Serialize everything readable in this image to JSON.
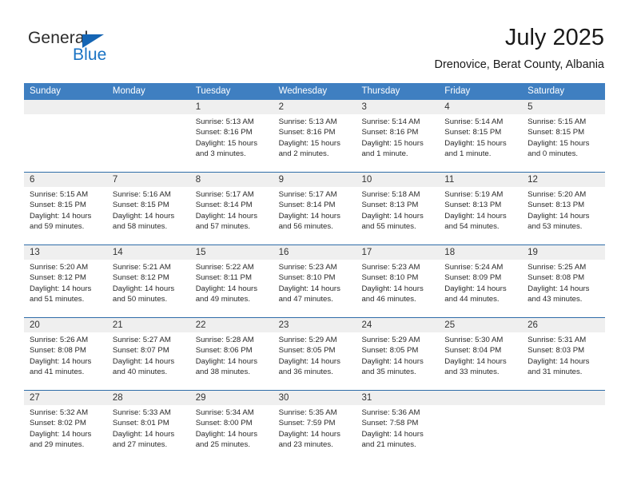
{
  "brand": {
    "name_top": "General",
    "name_bottom": "Blue",
    "accent_color": "#1a73c4",
    "triangle_color": "#1565b4"
  },
  "header": {
    "month_title": "July 2025",
    "location": "Drenovice, Berat County, Albania"
  },
  "theme": {
    "header_row_bg": "#3f7fc1",
    "number_band_bg": "#efefef",
    "row_divider": "#2f6da8",
    "text": "#2a2a2a"
  },
  "weekdays": [
    "Sunday",
    "Monday",
    "Tuesday",
    "Wednesday",
    "Thursday",
    "Friday",
    "Saturday"
  ],
  "weeks": [
    [
      {
        "day": "",
        "sunrise": "",
        "sunset": "",
        "daylight1": "",
        "daylight2": ""
      },
      {
        "day": "",
        "sunrise": "",
        "sunset": "",
        "daylight1": "",
        "daylight2": ""
      },
      {
        "day": "1",
        "sunrise": "Sunrise: 5:13 AM",
        "sunset": "Sunset: 8:16 PM",
        "daylight1": "Daylight: 15 hours",
        "daylight2": "and 3 minutes."
      },
      {
        "day": "2",
        "sunrise": "Sunrise: 5:13 AM",
        "sunset": "Sunset: 8:16 PM",
        "daylight1": "Daylight: 15 hours",
        "daylight2": "and 2 minutes."
      },
      {
        "day": "3",
        "sunrise": "Sunrise: 5:14 AM",
        "sunset": "Sunset: 8:16 PM",
        "daylight1": "Daylight: 15 hours",
        "daylight2": "and 1 minute."
      },
      {
        "day": "4",
        "sunrise": "Sunrise: 5:14 AM",
        "sunset": "Sunset: 8:15 PM",
        "daylight1": "Daylight: 15 hours",
        "daylight2": "and 1 minute."
      },
      {
        "day": "5",
        "sunrise": "Sunrise: 5:15 AM",
        "sunset": "Sunset: 8:15 PM",
        "daylight1": "Daylight: 15 hours",
        "daylight2": "and 0 minutes."
      }
    ],
    [
      {
        "day": "6",
        "sunrise": "Sunrise: 5:15 AM",
        "sunset": "Sunset: 8:15 PM",
        "daylight1": "Daylight: 14 hours",
        "daylight2": "and 59 minutes."
      },
      {
        "day": "7",
        "sunrise": "Sunrise: 5:16 AM",
        "sunset": "Sunset: 8:15 PM",
        "daylight1": "Daylight: 14 hours",
        "daylight2": "and 58 minutes."
      },
      {
        "day": "8",
        "sunrise": "Sunrise: 5:17 AM",
        "sunset": "Sunset: 8:14 PM",
        "daylight1": "Daylight: 14 hours",
        "daylight2": "and 57 minutes."
      },
      {
        "day": "9",
        "sunrise": "Sunrise: 5:17 AM",
        "sunset": "Sunset: 8:14 PM",
        "daylight1": "Daylight: 14 hours",
        "daylight2": "and 56 minutes."
      },
      {
        "day": "10",
        "sunrise": "Sunrise: 5:18 AM",
        "sunset": "Sunset: 8:13 PM",
        "daylight1": "Daylight: 14 hours",
        "daylight2": "and 55 minutes."
      },
      {
        "day": "11",
        "sunrise": "Sunrise: 5:19 AM",
        "sunset": "Sunset: 8:13 PM",
        "daylight1": "Daylight: 14 hours",
        "daylight2": "and 54 minutes."
      },
      {
        "day": "12",
        "sunrise": "Sunrise: 5:20 AM",
        "sunset": "Sunset: 8:13 PM",
        "daylight1": "Daylight: 14 hours",
        "daylight2": "and 53 minutes."
      }
    ],
    [
      {
        "day": "13",
        "sunrise": "Sunrise: 5:20 AM",
        "sunset": "Sunset: 8:12 PM",
        "daylight1": "Daylight: 14 hours",
        "daylight2": "and 51 minutes."
      },
      {
        "day": "14",
        "sunrise": "Sunrise: 5:21 AM",
        "sunset": "Sunset: 8:12 PM",
        "daylight1": "Daylight: 14 hours",
        "daylight2": "and 50 minutes."
      },
      {
        "day": "15",
        "sunrise": "Sunrise: 5:22 AM",
        "sunset": "Sunset: 8:11 PM",
        "daylight1": "Daylight: 14 hours",
        "daylight2": "and 49 minutes."
      },
      {
        "day": "16",
        "sunrise": "Sunrise: 5:23 AM",
        "sunset": "Sunset: 8:10 PM",
        "daylight1": "Daylight: 14 hours",
        "daylight2": "and 47 minutes."
      },
      {
        "day": "17",
        "sunrise": "Sunrise: 5:23 AM",
        "sunset": "Sunset: 8:10 PM",
        "daylight1": "Daylight: 14 hours",
        "daylight2": "and 46 minutes."
      },
      {
        "day": "18",
        "sunrise": "Sunrise: 5:24 AM",
        "sunset": "Sunset: 8:09 PM",
        "daylight1": "Daylight: 14 hours",
        "daylight2": "and 44 minutes."
      },
      {
        "day": "19",
        "sunrise": "Sunrise: 5:25 AM",
        "sunset": "Sunset: 8:08 PM",
        "daylight1": "Daylight: 14 hours",
        "daylight2": "and 43 minutes."
      }
    ],
    [
      {
        "day": "20",
        "sunrise": "Sunrise: 5:26 AM",
        "sunset": "Sunset: 8:08 PM",
        "daylight1": "Daylight: 14 hours",
        "daylight2": "and 41 minutes."
      },
      {
        "day": "21",
        "sunrise": "Sunrise: 5:27 AM",
        "sunset": "Sunset: 8:07 PM",
        "daylight1": "Daylight: 14 hours",
        "daylight2": "and 40 minutes."
      },
      {
        "day": "22",
        "sunrise": "Sunrise: 5:28 AM",
        "sunset": "Sunset: 8:06 PM",
        "daylight1": "Daylight: 14 hours",
        "daylight2": "and 38 minutes."
      },
      {
        "day": "23",
        "sunrise": "Sunrise: 5:29 AM",
        "sunset": "Sunset: 8:05 PM",
        "daylight1": "Daylight: 14 hours",
        "daylight2": "and 36 minutes."
      },
      {
        "day": "24",
        "sunrise": "Sunrise: 5:29 AM",
        "sunset": "Sunset: 8:05 PM",
        "daylight1": "Daylight: 14 hours",
        "daylight2": "and 35 minutes."
      },
      {
        "day": "25",
        "sunrise": "Sunrise: 5:30 AM",
        "sunset": "Sunset: 8:04 PM",
        "daylight1": "Daylight: 14 hours",
        "daylight2": "and 33 minutes."
      },
      {
        "day": "26",
        "sunrise": "Sunrise: 5:31 AM",
        "sunset": "Sunset: 8:03 PM",
        "daylight1": "Daylight: 14 hours",
        "daylight2": "and 31 minutes."
      }
    ],
    [
      {
        "day": "27",
        "sunrise": "Sunrise: 5:32 AM",
        "sunset": "Sunset: 8:02 PM",
        "daylight1": "Daylight: 14 hours",
        "daylight2": "and 29 minutes."
      },
      {
        "day": "28",
        "sunrise": "Sunrise: 5:33 AM",
        "sunset": "Sunset: 8:01 PM",
        "daylight1": "Daylight: 14 hours",
        "daylight2": "and 27 minutes."
      },
      {
        "day": "29",
        "sunrise": "Sunrise: 5:34 AM",
        "sunset": "Sunset: 8:00 PM",
        "daylight1": "Daylight: 14 hours",
        "daylight2": "and 25 minutes."
      },
      {
        "day": "30",
        "sunrise": "Sunrise: 5:35 AM",
        "sunset": "Sunset: 7:59 PM",
        "daylight1": "Daylight: 14 hours",
        "daylight2": "and 23 minutes."
      },
      {
        "day": "31",
        "sunrise": "Sunrise: 5:36 AM",
        "sunset": "Sunset: 7:58 PM",
        "daylight1": "Daylight: 14 hours",
        "daylight2": "and 21 minutes."
      },
      {
        "day": "",
        "sunrise": "",
        "sunset": "",
        "daylight1": "",
        "daylight2": ""
      },
      {
        "day": "",
        "sunrise": "",
        "sunset": "",
        "daylight1": "",
        "daylight2": ""
      }
    ]
  ]
}
